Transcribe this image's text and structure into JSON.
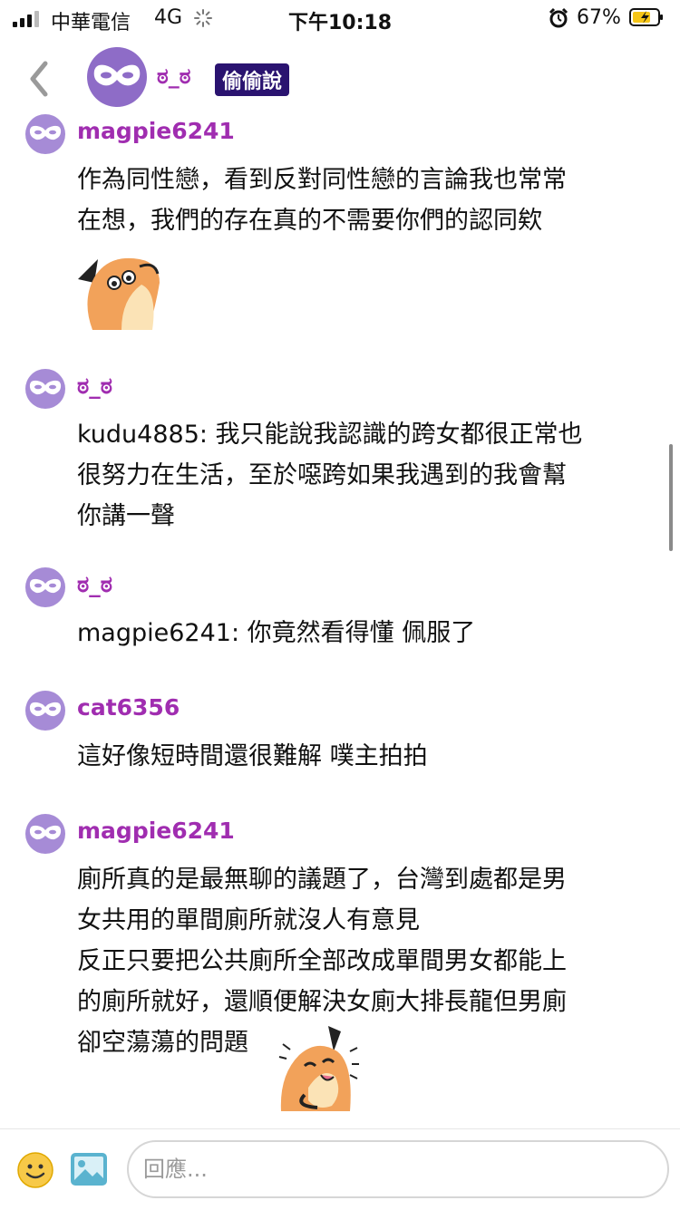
{
  "status_bar": {
    "carrier": "中華電信",
    "network": "4G",
    "time": "下午10:18",
    "battery": "67%"
  },
  "header": {
    "back_icon": "chevron-left-icon",
    "avatar_icon": "mask-icon",
    "name": "ಠ_ಠ",
    "badge": "偷偷說"
  },
  "comments": [
    {
      "name": "magpie6241",
      "text": "作為同性戀，看到反對同性戀的言論我也常常\n在想，我們的存在真的不需要你們的認同欸",
      "sticker": "fox-sticker"
    },
    {
      "name": "ಠ_ಠ",
      "text": "kudu4885: 我只能說我認識的跨女都很正常也\n很努力在生活，至於噁跨如果我遇到的我會幫\n你講一聲"
    },
    {
      "name": "ಠ_ಠ",
      "text": "magpie6241: 你竟然看得懂 佩服了"
    },
    {
      "name": "cat6356",
      "text": "這好像短時間還很難解 噗主拍拍"
    },
    {
      "name": "magpie6241",
      "text": "廁所真的是最無聊的議題了，台灣到處都是男\n女共用的單間廁所就沒人有意見\n反正只要把公共廁所全部改成單間男女都能上\n的廁所就好，還順便解決女廁大排長龍但男廁\n卻空蕩蕩的問題",
      "sticker": "fox-laughing-sticker"
    }
  ],
  "bottom_bar": {
    "emoji_icon": "smiley-icon",
    "image_icon": "image-icon",
    "reply_placeholder": "回應..."
  },
  "colors": {
    "username": "#a02db0",
    "badge_bg": "#2a1370",
    "avatar": "#a68bd6"
  }
}
